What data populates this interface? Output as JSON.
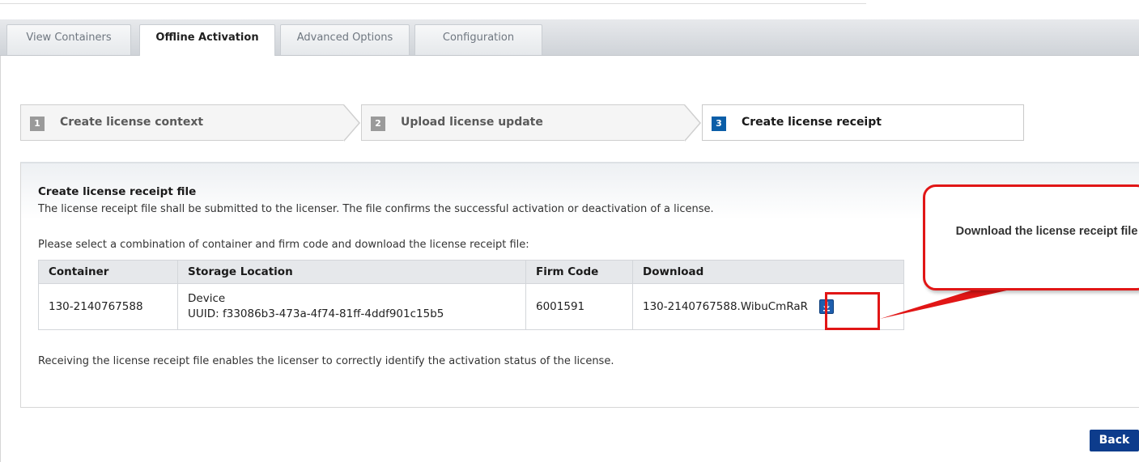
{
  "tabs": [
    {
      "label": "View Containers",
      "active": false
    },
    {
      "label": "Offline Activation",
      "active": true
    },
    {
      "label": "Advanced Options",
      "active": false
    },
    {
      "label": "Configuration",
      "active": false
    }
  ],
  "steps": [
    {
      "number": "1",
      "label": "Create license context",
      "active": false
    },
    {
      "number": "2",
      "label": "Upload license update",
      "active": false
    },
    {
      "number": "3",
      "label": "Create license receipt",
      "active": true
    }
  ],
  "panel": {
    "title": "Create license receipt file",
    "description": "The license receipt file shall be submitted to the licenser. The file confirms the successful activation or deactivation of a license.",
    "select_instruction": "Please select a combination of container and firm code and download the license receipt file:",
    "footer": "Receiving the license receipt file enables the licenser to correctly identify the activation status of the license."
  },
  "table": {
    "headers": [
      "Container",
      "Storage Location",
      "Firm Code",
      "Download"
    ],
    "rows": [
      {
        "container": "130-2140767588",
        "storage_location": "Device",
        "storage_uuid": "UUID: f33086b3-473a-4f74-81ff-4ddf901c15b5",
        "firm_code": "6001591",
        "download_file": "130-2140767588.WibuCmRaR",
        "download_icon": "download-icon"
      }
    ]
  },
  "callout": {
    "text": "Download the license receipt file",
    "border_color": "#e11616"
  },
  "buttons": {
    "back": "Back"
  },
  "colors": {
    "accent": "#0b5ea8",
    "button": "#0d3c8c"
  }
}
